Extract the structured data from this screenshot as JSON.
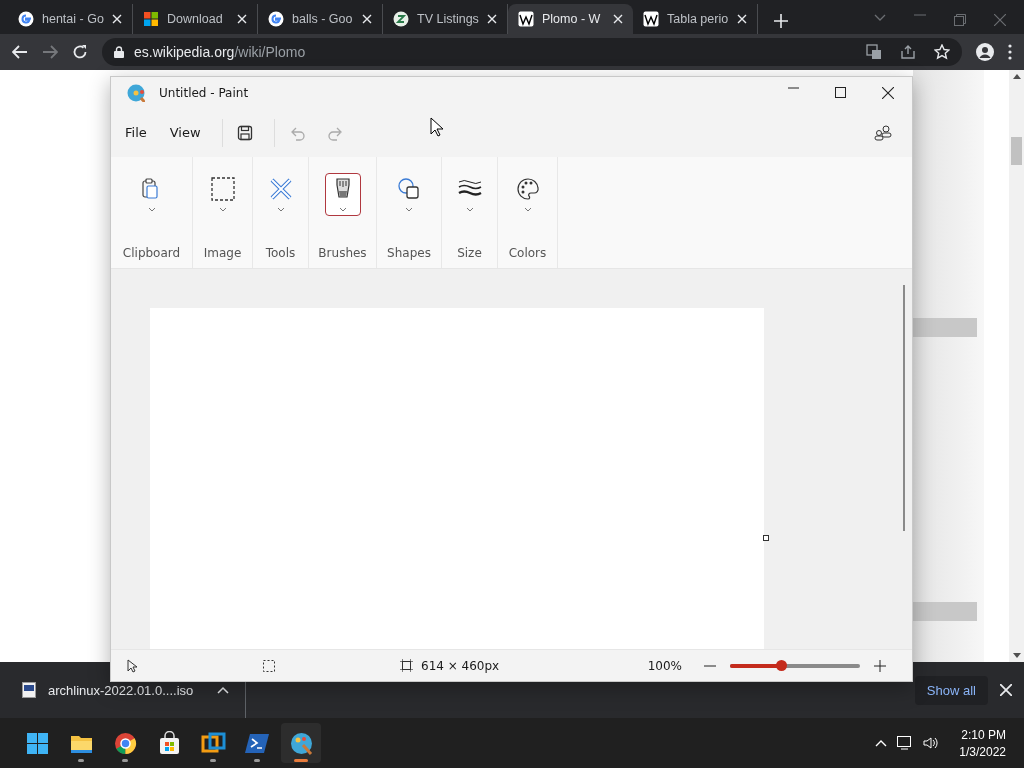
{
  "browser": {
    "tabs": [
      {
        "title": "hentai - Go",
        "kind": "google",
        "selected": false
      },
      {
        "title": "Download",
        "kind": "microsoft",
        "selected": false
      },
      {
        "title": "balls - Goo",
        "kind": "google",
        "selected": false
      },
      {
        "title": "TV Listings",
        "kind": "zap",
        "selected": false
      },
      {
        "title": "Plomo - W",
        "kind": "wikipedia",
        "selected": true
      },
      {
        "title": "Tabla perio",
        "kind": "wikipedia",
        "selected": false
      }
    ],
    "url_host": "es.wikipedia.org",
    "url_path": "/wiki/Plomo"
  },
  "paint": {
    "title": "Untitled - Paint",
    "menu": [
      "File",
      "View"
    ],
    "toolbar": [
      {
        "kind": "save",
        "disabled": false
      },
      {
        "kind": "undo",
        "disabled": true
      },
      {
        "kind": "redo",
        "disabled": true
      }
    ],
    "groups": [
      {
        "label": "Clipboard",
        "kind": "clipboard",
        "selected": false
      },
      {
        "label": "Image",
        "kind": "image",
        "selected": false
      },
      {
        "label": "Tools",
        "kind": "tools",
        "selected": false
      },
      {
        "label": "Brushes",
        "kind": "brushes",
        "selected": true
      },
      {
        "label": "Shapes",
        "kind": "shapes",
        "selected": false
      },
      {
        "label": "Size",
        "kind": "size",
        "selected": false
      },
      {
        "label": "Colors",
        "kind": "colors",
        "selected": false
      }
    ],
    "canvas_size": "614 × 460px",
    "zoom": "100%",
    "zoom_slider": {
      "level": 0.39
    }
  },
  "downloads": {
    "file": "archlinux-2022.01.0....iso",
    "show_all": "Show all"
  },
  "taskbar": {
    "apps": [
      {
        "kind": "start",
        "running": false,
        "selected": false
      },
      {
        "kind": "explorer",
        "running": true,
        "selected": false
      },
      {
        "kind": "chrome",
        "running": true,
        "selected": false
      },
      {
        "kind": "store",
        "running": false,
        "selected": false
      },
      {
        "kind": "vmware",
        "running": true,
        "selected": false
      },
      {
        "kind": "powershell",
        "running": true,
        "selected": false
      },
      {
        "kind": "paint",
        "running": true,
        "selected": true
      }
    ],
    "time": "2:10 PM",
    "date": "1/3/2022"
  }
}
